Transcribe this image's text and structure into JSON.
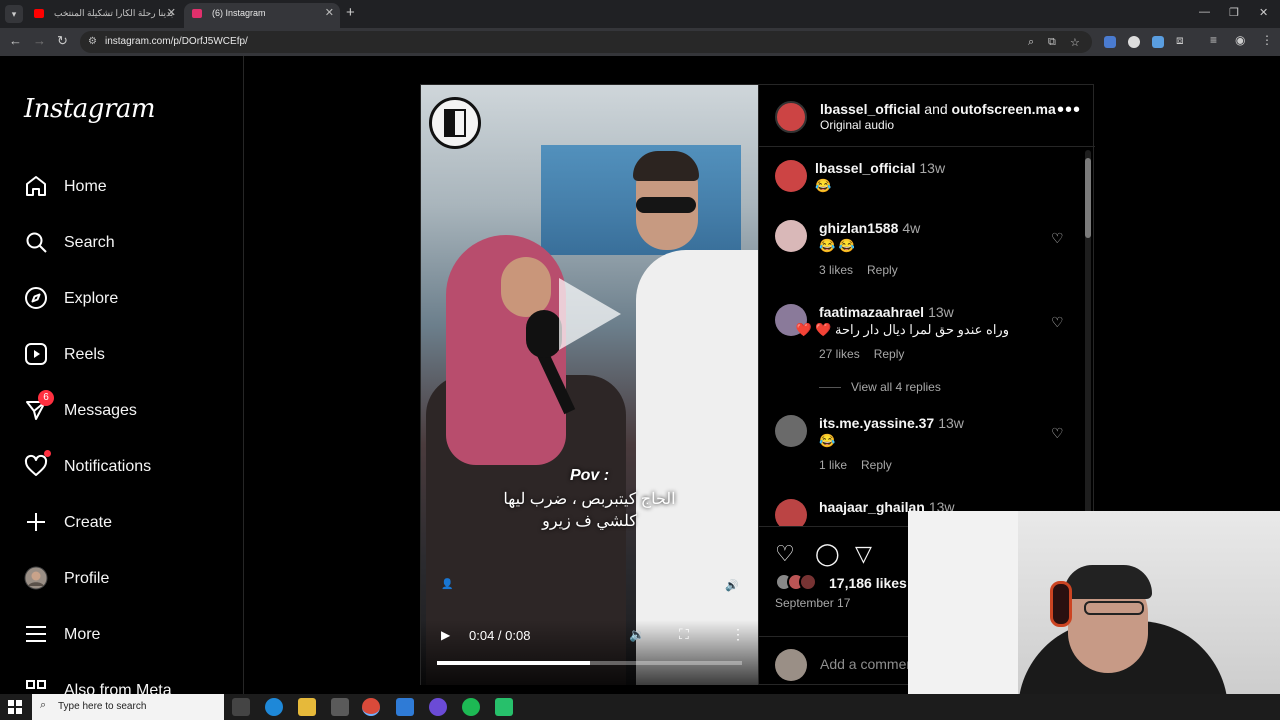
{
  "browser": {
    "tabs": [
      {
        "title": "بدينا رحلة الكارا تشكيلة المنتخب",
        "favicon_color": "#ff0000",
        "active": false
      },
      {
        "title": "(6) Instagram",
        "favicon_color": "#e1306c",
        "active": true
      }
    ],
    "url": "instagram.com/p/DOrfJ5WCEfp/"
  },
  "sidebar": {
    "logo": "Instagram",
    "items": [
      {
        "label": "Home",
        "icon": "home-icon"
      },
      {
        "label": "Search",
        "icon": "search-icon"
      },
      {
        "label": "Explore",
        "icon": "compass-icon"
      },
      {
        "label": "Reels",
        "icon": "reels-icon"
      },
      {
        "label": "Messages",
        "icon": "messenger-icon",
        "badge": "6"
      },
      {
        "label": "Notifications",
        "icon": "heart-icon"
      },
      {
        "label": "Create",
        "icon": "plus-icon"
      },
      {
        "label": "Profile",
        "icon": "avatar-icon"
      },
      {
        "label": "More",
        "icon": "menu-icon"
      },
      {
        "label": "Also from Meta",
        "icon": "meta-icon"
      }
    ]
  },
  "post": {
    "author": "lbassel_official",
    "and": "and",
    "coauthor": "outofscreen.ma",
    "audio": "Original audio",
    "video": {
      "overlay_line1": "Pov :",
      "overlay_line2": "الحاج كيتبربص ، ضرب ليها",
      "overlay_line3": "كلشي ف زيرو",
      "time": "0:04 / 0:08",
      "progress": 0.5
    },
    "caption": {
      "user": "lbassel_official",
      "ago": "13w",
      "text": "😂"
    },
    "comments": [
      {
        "user": "ghizlan1588",
        "ago": "4w",
        "text": "😂 😂",
        "likes": "3 likes",
        "reply": "Reply",
        "avatar_color": "#d9b8b8"
      },
      {
        "user": "faatimazaahrael",
        "ago": "13w",
        "text": "وراه عندو حق لمرا ديال دار راحة ❤️ ❤️",
        "likes": "27 likes",
        "reply": "Reply",
        "avatar_color": "#8a7a9a"
      },
      {
        "user": "its.me.yassine.37",
        "ago": "13w",
        "text": "😂",
        "likes": "1 like",
        "reply": "Reply",
        "avatar_color": "#6a6a6a"
      },
      {
        "user": "haajaar_ghailan",
        "ago": "13w",
        "text": "",
        "likes": "",
        "reply": "",
        "avatar_color": "#b44"
      }
    ],
    "view_replies": "View all 4 replies",
    "likes_count": "17,186 likes",
    "date": "September 17",
    "add_comment_placeholder": "Add a comment…"
  },
  "taskbar": {
    "search_placeholder": "Type here to search"
  }
}
